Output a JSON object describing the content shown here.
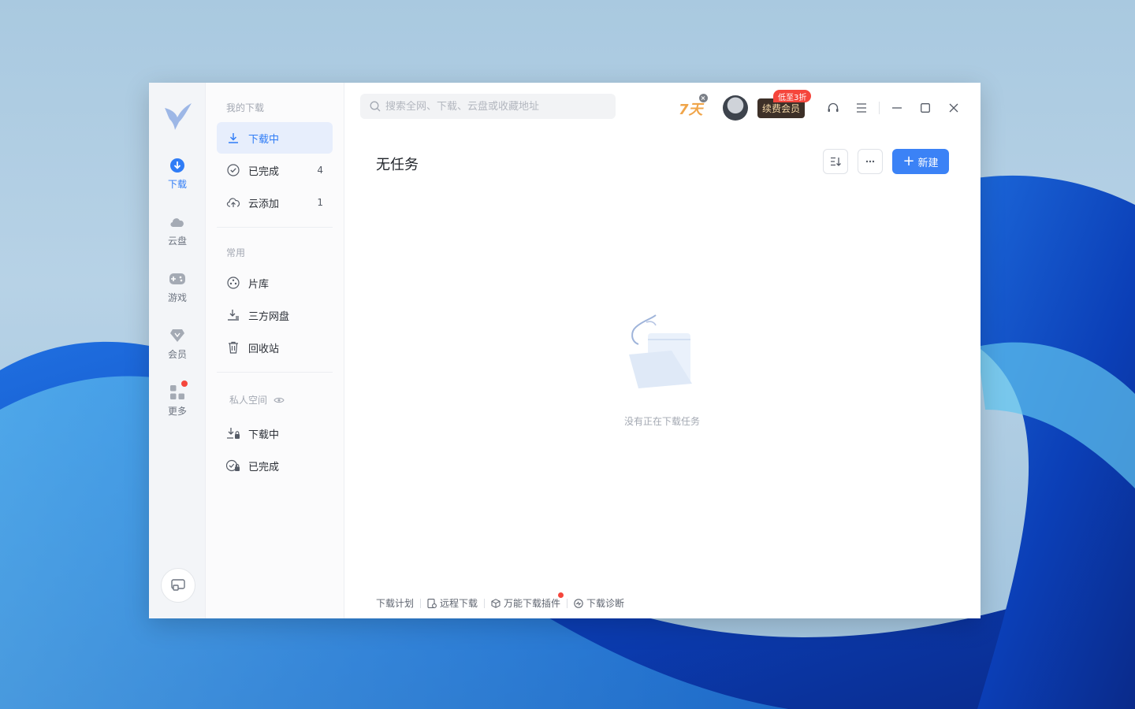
{
  "sidebar": {
    "items": [
      {
        "label": "下载",
        "icon": "download-circle-icon",
        "active": true
      },
      {
        "label": "云盘",
        "icon": "cloud-icon"
      },
      {
        "label": "游戏",
        "icon": "gamepad-icon"
      },
      {
        "label": "会员",
        "icon": "diamond-icon"
      },
      {
        "label": "更多",
        "icon": "apps-grid-icon",
        "notification_dot": true
      }
    ]
  },
  "menu": {
    "my_downloads_title": "我的下载",
    "downloading": "下载中",
    "completed": "已完成",
    "completed_count": "4",
    "cloud_add": "云添加",
    "cloud_add_count": "1",
    "common_title": "常用",
    "library": "片库",
    "third_party_disk": "三方网盘",
    "recycle_bin": "回收站",
    "private_title": "私人空间",
    "private_downloading": "下载中",
    "private_completed": "已完成"
  },
  "header": {
    "search_placeholder": "搜索全网、下载、云盘或收藏地址",
    "trial_badge": "7天",
    "vip_button": "续费会员",
    "vip_tag": "低至3折"
  },
  "main": {
    "title": "无任务",
    "new_button": "新建",
    "empty_text": "没有正在下载任务"
  },
  "footer": {
    "plan": "下载计划",
    "remote": "远程下载",
    "plugin": "万能下载插件",
    "diagnose": "下载诊断"
  },
  "colors": {
    "accent": "#3b82f6",
    "active_bg": "#e7eefc",
    "notification": "#f5463c"
  }
}
